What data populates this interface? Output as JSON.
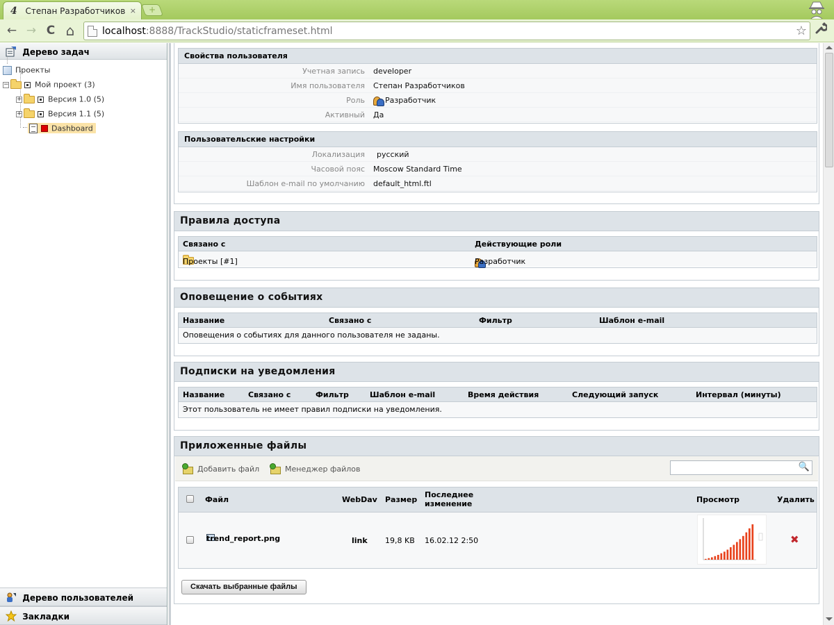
{
  "browser": {
    "tab_title": "Степан Разработчиков",
    "tab_favicon_glyph": "4",
    "tab_close": "×",
    "new_tab": "+",
    "url_host": "localhost",
    "url_rest": ":8888/TrackStudio/staticframeset.html",
    "back": "←",
    "forward": "→",
    "reload": "C",
    "home": "⌂",
    "star": "☆",
    "wrench": "🔧"
  },
  "left": {
    "task_tree_header": "Дерево задач",
    "tree": [
      {
        "label": "Проекты"
      },
      {
        "label": "Мой проект (3)"
      },
      {
        "label": "Версия 1.0 (5)"
      },
      {
        "label": "Версия 1.1 (5)"
      },
      {
        "label": "Dashboard"
      }
    ],
    "user_tree_header": "Дерево пользователей",
    "bookmarks_header": "Закладки"
  },
  "user_props": {
    "title": "Свойства пользователя",
    "rows": [
      {
        "label": "Учетная запись",
        "value": "developer"
      },
      {
        "label": "Имя пользователя",
        "value": "Степан Разработчиков"
      },
      {
        "label": "Роль",
        "value": "Разработчик"
      },
      {
        "label": "Активный",
        "value": "Да"
      }
    ]
  },
  "user_settings": {
    "title": "Пользовательские настройки",
    "rows": [
      {
        "label": "Локализация",
        "value": "русский"
      },
      {
        "label": "Часовой пояс",
        "value": "Moscow Standard Time"
      },
      {
        "label": "Шаблон e-mail по умолчанию",
        "value": "default_html.ftl"
      }
    ]
  },
  "access": {
    "title": "Правила доступа",
    "headers": [
      "Связано с",
      "Действующие роли"
    ],
    "row": {
      "linked": "Проекты [#1]",
      "role": "Разработчик"
    }
  },
  "events": {
    "title": "Оповещение о событиях",
    "headers": [
      "Название",
      "Связано с",
      "Фильтр",
      "Шаблон e-mail"
    ],
    "empty": "Оповещения о событиях для данного пользователя не заданы."
  },
  "subscriptions": {
    "title": "Подписки на уведомления",
    "headers": [
      "Название",
      "Связано с",
      "Фильтр",
      "Шаблон e-mail",
      "Время действия",
      "Следующий запуск",
      "Интервал (минуты)"
    ],
    "empty": "Этот пользователь не имеет правил подписки на уведомления."
  },
  "attachments": {
    "title": "Приложенные файлы",
    "add_file": "Добавить файл",
    "file_manager": "Менеджер файлов",
    "search_value": "",
    "headers": {
      "file": "Файл",
      "webdav": "WebDav",
      "size": "Размер",
      "modified_1": "Последнее",
      "modified_2": "изменение",
      "preview": "Просмотр",
      "delete": "Удалить"
    },
    "file": {
      "name": "trend_report.png",
      "webdav": "link",
      "size": "19,8 KB",
      "modified": "16.02.12 2:50",
      "delete_glyph": "✖"
    },
    "download_button": "Скачать выбранные файлы"
  },
  "thumbnail": {
    "bar_color": "#e8421c",
    "bars": [
      0.02,
      0.04,
      0.06,
      0.09,
      0.12,
      0.16,
      0.2,
      0.25,
      0.31,
      0.37,
      0.44,
      0.51,
      0.59,
      0.68,
      0.78,
      0.88
    ]
  }
}
